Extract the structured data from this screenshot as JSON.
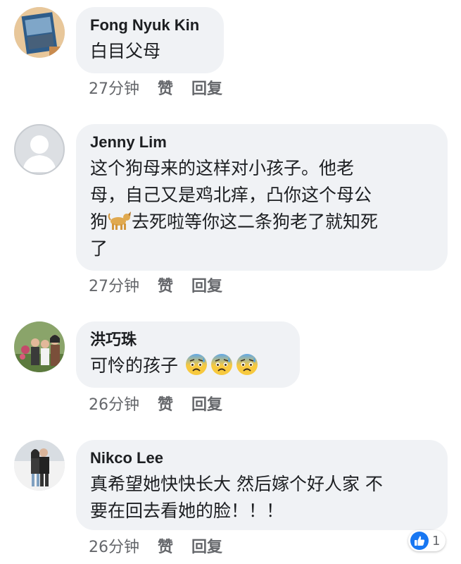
{
  "comments": [
    {
      "author": "Fong Nyuk Kin",
      "text": "白目父母",
      "time": "27分钟",
      "like_label": "赞",
      "reply_label": "回复",
      "avatar": "book-photo"
    },
    {
      "author": "Jenny Lim",
      "text_lines": [
        "这个狗母来的这样对小孩子。他老",
        "母，自己又是鸡北痒，凸你这个母公",
        "去死啦等你这二条狗老了就知死",
        "了"
      ],
      "text_line3_prefix": "狗",
      "dog_emoji": "dog-emoji",
      "time": "27分钟",
      "like_label": "赞",
      "reply_label": "回复",
      "avatar": "default-profile"
    },
    {
      "author": "洪巧珠",
      "text": "可怜的孩子",
      "emoji": "anxious-face-with-sweat",
      "time": "26分钟",
      "like_label": "赞",
      "reply_label": "回复",
      "avatar": "group-photo"
    },
    {
      "author": "Nikco Lee",
      "text_lines": [
        "真希望她快快长大 然后嫁个好人家 不",
        "要在回去看她的脸！！！"
      ],
      "time": "26分钟",
      "like_label": "赞",
      "reply_label": "回复",
      "avatar": "couple-photo",
      "reaction_count": "1"
    }
  ],
  "colors": {
    "bubble": "#f0f2f5",
    "meta": "#65676b",
    "like": "#1877f2"
  }
}
